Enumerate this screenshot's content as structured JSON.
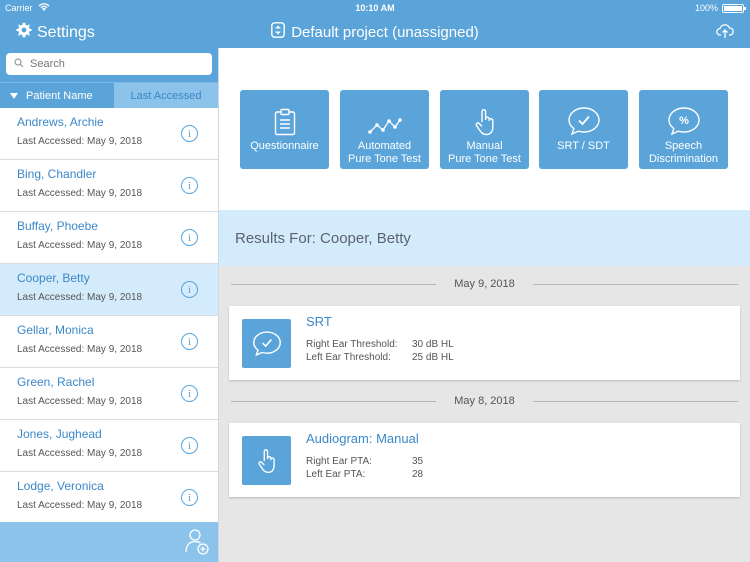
{
  "status": {
    "carrier": "Carrier",
    "time": "10:10 AM",
    "battery": "100%"
  },
  "nav": {
    "settings_label": "Settings",
    "project_title": "Default project (unassigned)"
  },
  "sidebar": {
    "search_placeholder": "Search",
    "sort": {
      "name_label": "Patient Name",
      "accessed_label": "Last Accessed"
    },
    "patients": [
      {
        "name": "Andrews, Archie",
        "accessed": "Last Accessed: May 9, 2018"
      },
      {
        "name": "Bing, Chandler",
        "accessed": "Last Accessed: May 9, 2018"
      },
      {
        "name": "Buffay, Phoebe",
        "accessed": "Last Accessed: May 9, 2018"
      },
      {
        "name": "Cooper, Betty",
        "accessed": "Last Accessed: May 9, 2018"
      },
      {
        "name": "Gellar, Monica",
        "accessed": "Last Accessed: May 9, 2018"
      },
      {
        "name": "Green, Rachel",
        "accessed": "Last Accessed: May 9, 2018"
      },
      {
        "name": "Jones, Jughead",
        "accessed": "Last Accessed: May 9, 2018"
      },
      {
        "name": "Lodge, Veronica",
        "accessed": "Last Accessed: May 9, 2018"
      }
    ],
    "selected_patient": "Cooper, Betty"
  },
  "tests": [
    {
      "line1": "Questionnaire",
      "line2": "",
      "icon": "clipboard-icon"
    },
    {
      "line1": "Automated",
      "line2": "Pure Tone Test",
      "icon": "waveform-icon"
    },
    {
      "line1": "Manual",
      "line2": "Pure Tone Test",
      "icon": "hand-pointer-icon"
    },
    {
      "line1": "SRT / SDT",
      "line2": "",
      "icon": "speech-check-icon"
    },
    {
      "line1": "Speech",
      "line2": "Discrimination",
      "icon": "speech-percent-icon"
    }
  ],
  "results": {
    "header": "Results For: Cooper, Betty",
    "groups": [
      {
        "date": "May 9, 2018",
        "title": "SRT",
        "icon": "speech-check-icon",
        "rows": [
          {
            "label": "Right Ear Threshold:",
            "value": "30 dB HL"
          },
          {
            "label": "Left Ear Threshold:",
            "value": "25 dB HL"
          }
        ]
      },
      {
        "date": "May 8, 2018",
        "title": "Audiogram: Manual",
        "icon": "hand-pointer-icon",
        "rows": [
          {
            "label": "Right Ear PTA:",
            "value": "35"
          },
          {
            "label": "Left Ear PTA:",
            "value": "28"
          }
        ]
      }
    ]
  },
  "colors": {
    "primary": "#5aa4da",
    "light": "#d3ebfa",
    "accent": "#3b88c9"
  }
}
